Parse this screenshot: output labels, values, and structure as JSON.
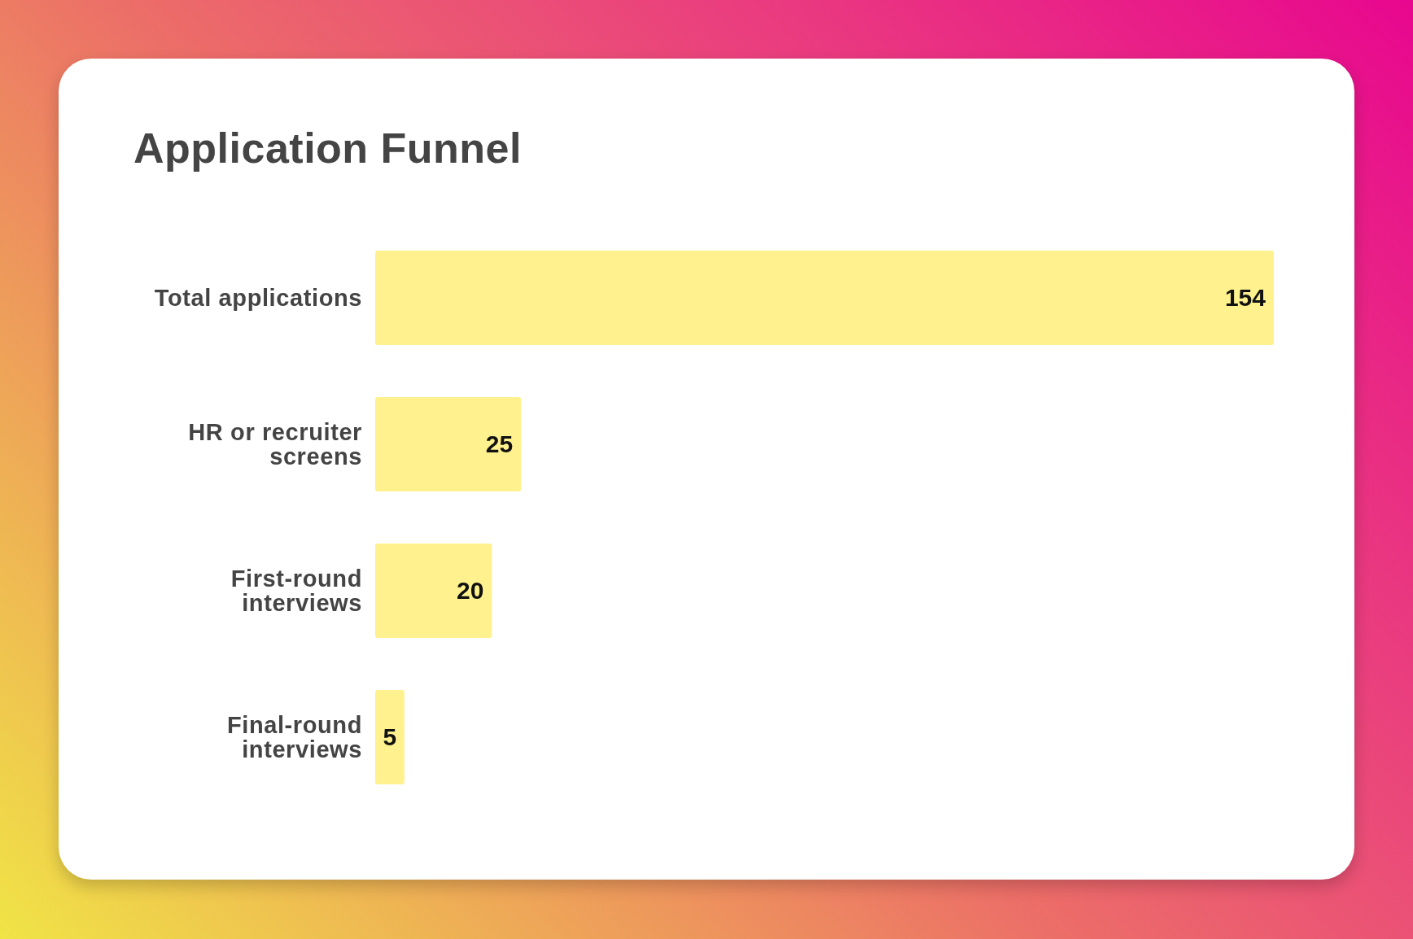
{
  "card": {
    "title": "Application Funnel",
    "chart_data": {
      "type": "bar",
      "orientation": "horizontal",
      "data_labels": true,
      "categories": [
        "Total applications",
        "HR or recruiter screens",
        "First-round interviews",
        "Final-round interviews"
      ],
      "values": [
        154,
        25,
        20,
        5
      ]
    }
  }
}
